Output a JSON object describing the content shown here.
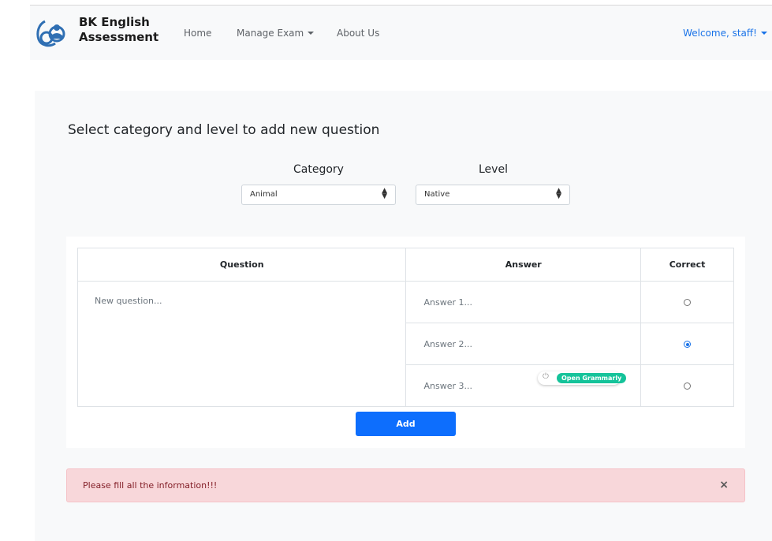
{
  "navbar": {
    "brand_line1": "BK English",
    "brand_line2": "Assessment",
    "links": {
      "home": "Home",
      "manage_exam": "Manage Exam",
      "about": "About Us"
    },
    "welcome": "Welcome, staff!"
  },
  "form": {
    "title": "Select category and level to add new question",
    "category_label": "Category",
    "category_value": "Animal",
    "level_label": "Level",
    "level_value": "Native"
  },
  "table": {
    "headers": {
      "question": "Question",
      "answer": "Answer",
      "correct": "Correct"
    },
    "question_placeholder": "New question...",
    "answers": [
      {
        "placeholder": "Answer 1...",
        "correct": false
      },
      {
        "placeholder": "Answer 2...",
        "correct": true
      },
      {
        "placeholder": "Answer 3...",
        "correct": false
      }
    ]
  },
  "grammarly": {
    "label": "Open Grammarly"
  },
  "add_button": "Add",
  "alert": {
    "message": "Please fill all the information!!!",
    "close": "×"
  },
  "colors": {
    "primary": "#0d6efd",
    "alert_bg": "#f8d7da",
    "alert_text": "#842029",
    "grammarly": "#15c39a"
  }
}
